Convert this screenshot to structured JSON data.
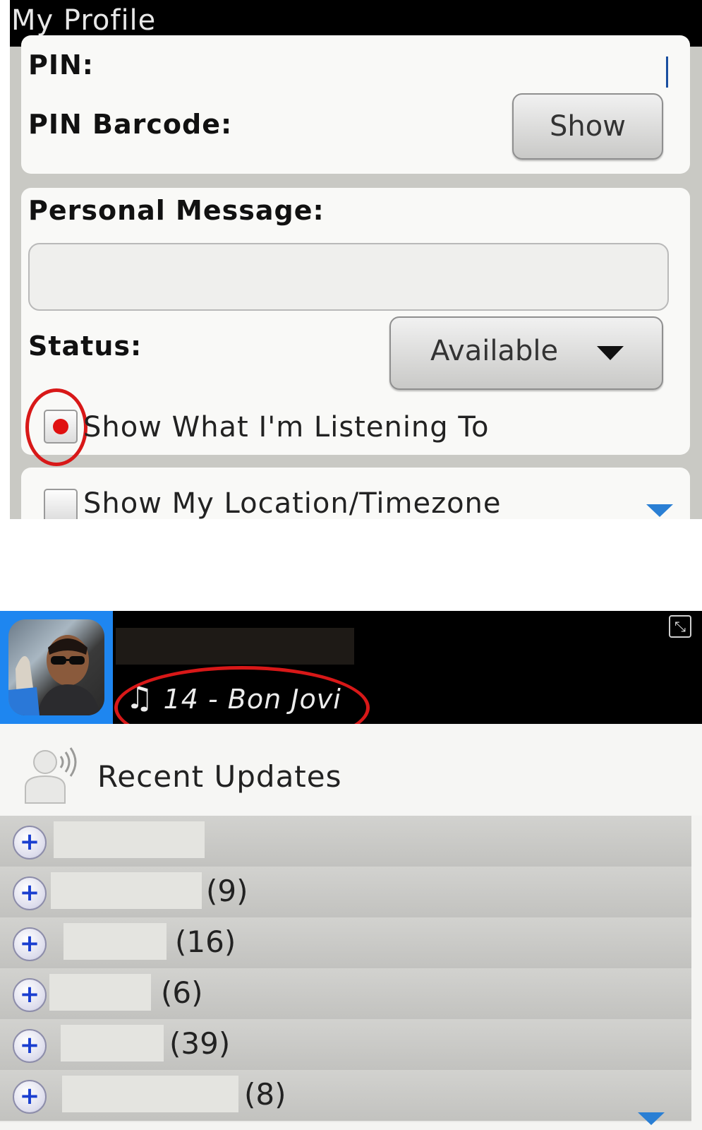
{
  "profile": {
    "title": "My Profile",
    "pin_label": "PIN:",
    "pin_barcode_label": "PIN Barcode:",
    "show_button": "Show",
    "personal_message_label": "Personal Message:",
    "personal_message_value": "",
    "status_label": "Status:",
    "status_value": "Available",
    "listening_checkbox_label": "Show What I'm Listening To",
    "listening_checked": true,
    "location_checkbox_label": "Show My Location/Timezone",
    "location_checked": false
  },
  "contacts": {
    "now_playing": "14 - Bon Jovi",
    "recent_updates_label": "Recent Updates",
    "groups": [
      {
        "count": ""
      },
      {
        "count": "(9)"
      },
      {
        "count": "(16)"
      },
      {
        "count": "(6)"
      },
      {
        "count": "(39)"
      },
      {
        "count": "(8)"
      }
    ]
  },
  "colors": {
    "annotation_red": "#d81818",
    "accent_blue": "#1e86f0",
    "titlebar": "#000000"
  }
}
